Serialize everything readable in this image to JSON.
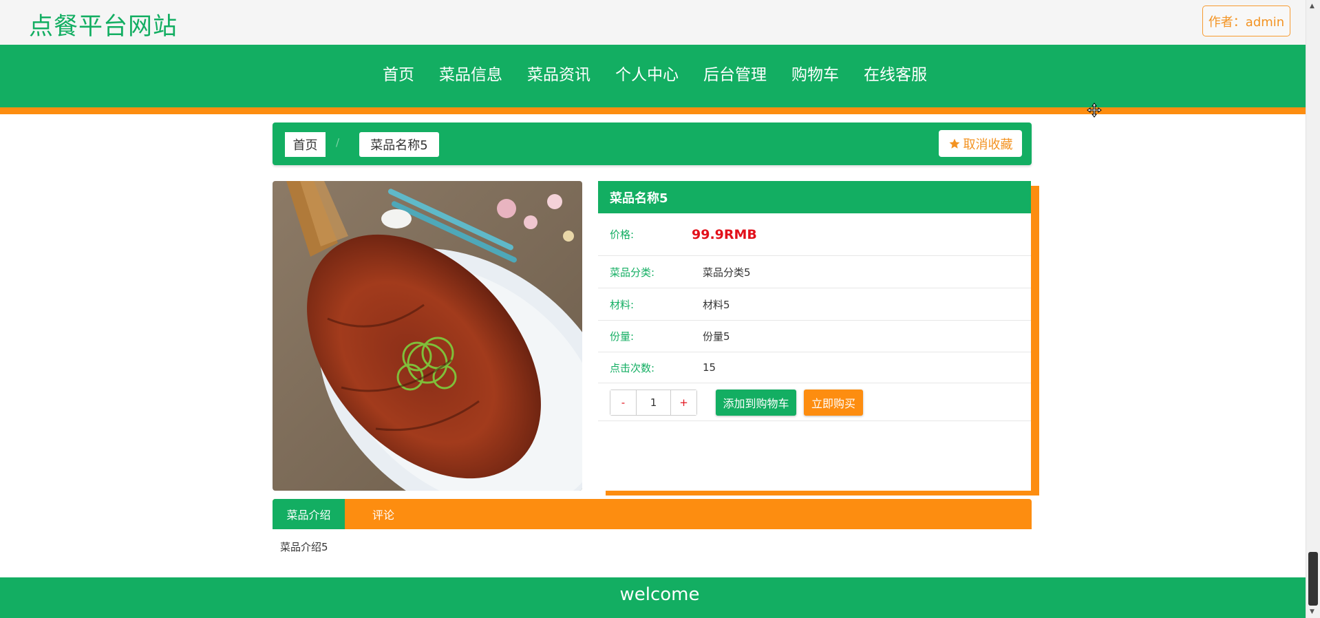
{
  "header": {
    "site_title": "点餐平台网站",
    "author_label": "作者：admin"
  },
  "nav": {
    "items": [
      "首页",
      "菜品信息",
      "菜品资讯",
      "个人中心",
      "后台管理",
      "购物车",
      "在线客服"
    ]
  },
  "breadcrumb": {
    "home": "首页",
    "separator": "/",
    "current": "菜品名称5",
    "unfavorite_label": "取消收藏"
  },
  "product": {
    "name": "菜品名称5",
    "price_label": "价格:",
    "price_value": "99.9RMB",
    "fields": [
      {
        "label": "菜品分类:",
        "value": "菜品分类5"
      },
      {
        "label": "材料:",
        "value": "材料5"
      },
      {
        "label": "份量:",
        "value": "份量5"
      },
      {
        "label": "点击次数:",
        "value": "15"
      }
    ],
    "qty_minus": "-",
    "qty_value": "1",
    "qty_plus": "+",
    "add_to_cart_label": "添加到购物车",
    "buy_now_label": "立即购买"
  },
  "tabs": {
    "intro_label": "菜品介绍",
    "comment_label": "评论",
    "content": "菜品介绍5"
  },
  "footer": {
    "text": "welcome"
  },
  "colors": {
    "primary_green": "#13ae62",
    "accent_orange": "#fd8d10",
    "price_red": "#e2111b"
  }
}
